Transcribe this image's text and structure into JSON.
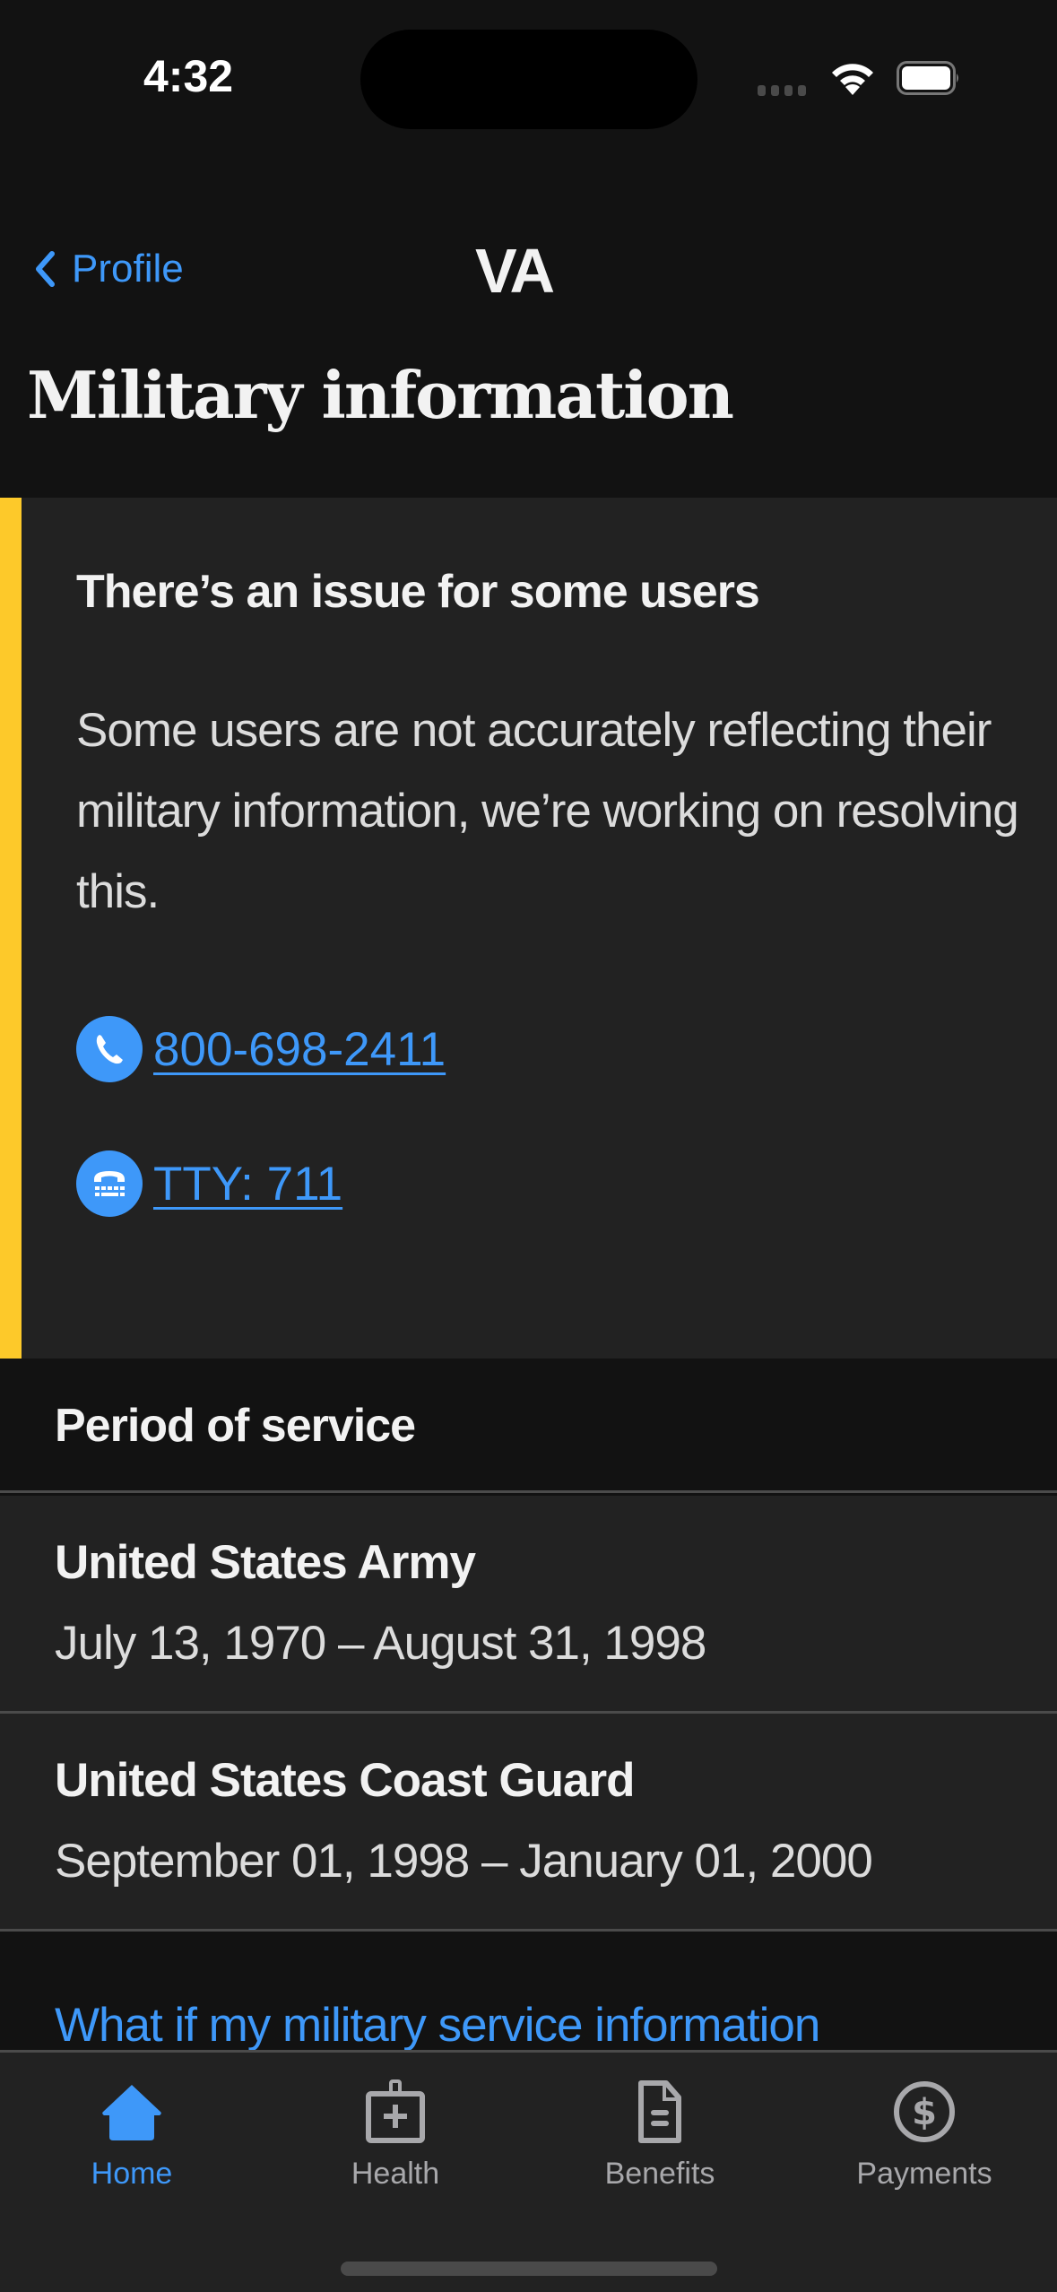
{
  "status_bar": {
    "time": "4:32"
  },
  "nav": {
    "back_label": "Profile",
    "title": "VA"
  },
  "page": {
    "title": "Military information"
  },
  "alert": {
    "title": "There’s an issue for some users",
    "body": "Some users are not accurately reflecting their military information, we’re working on resolving this.",
    "accent_color": "#fdc92a",
    "phone_label": "800-698-2411",
    "tty_label": "TTY: 711"
  },
  "service": {
    "header": "Period of service",
    "items": [
      {
        "branch": "United States Army",
        "dates": "July 13, 1970 – August 31, 1998"
      },
      {
        "branch": "United States Coast Guard",
        "dates": "September 01, 1998 – January 01, 2000"
      }
    ]
  },
  "help_link": "What if my military service information",
  "tabs": [
    {
      "label": "Home",
      "icon": "home-icon",
      "active": true
    },
    {
      "label": "Health",
      "icon": "medkit-icon",
      "active": false
    },
    {
      "label": "Benefits",
      "icon": "document-icon",
      "active": false
    },
    {
      "label": "Payments",
      "icon": "dollar-circle-icon",
      "active": false
    }
  ],
  "colors": {
    "link": "#3e98f9",
    "background": "#121212",
    "surface": "#222222",
    "alert_accent": "#fdc92a"
  }
}
